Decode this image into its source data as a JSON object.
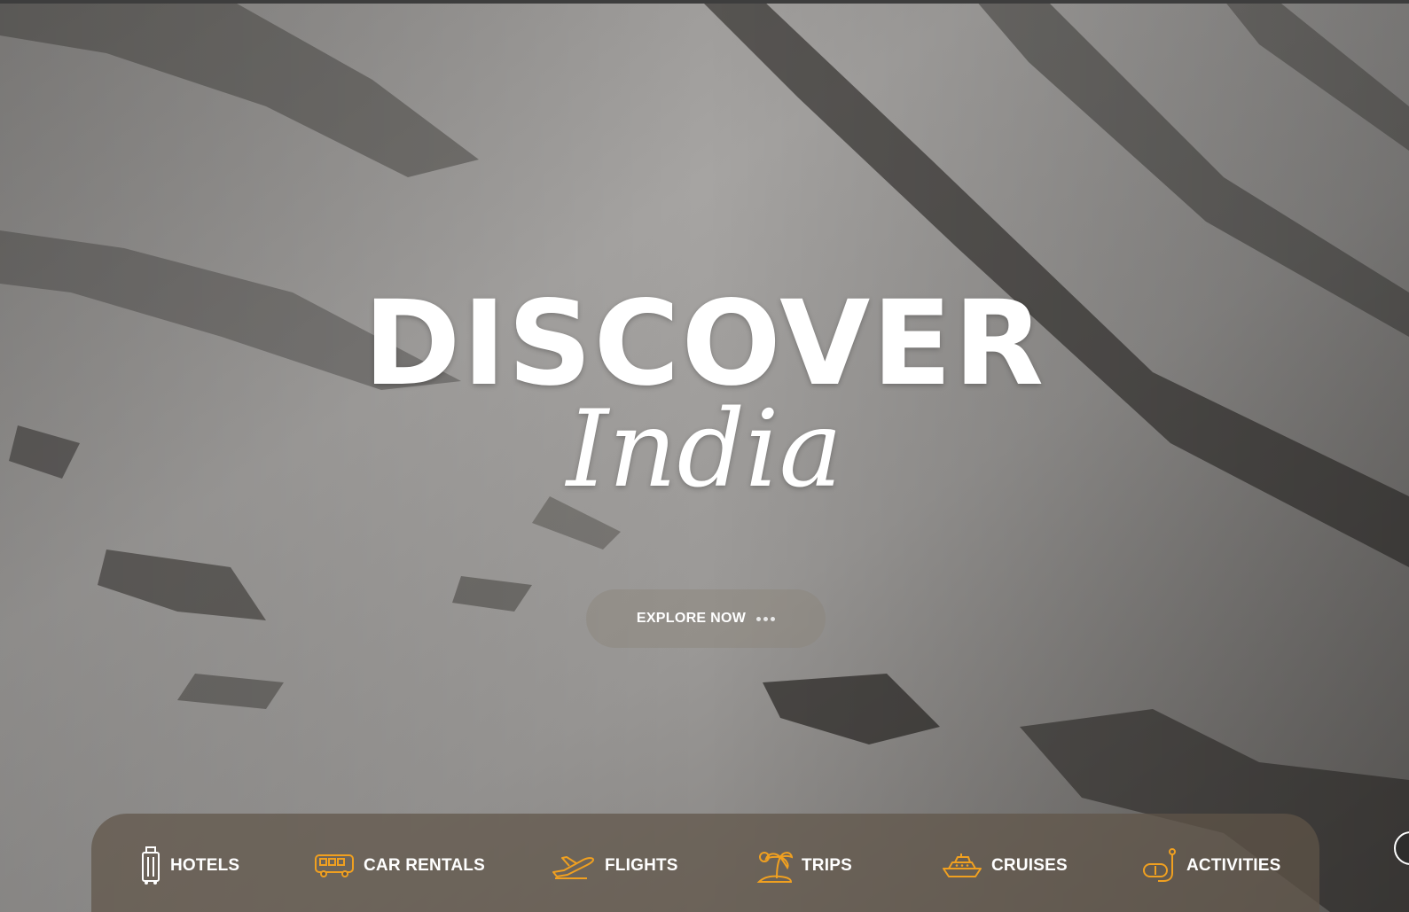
{
  "hero": {
    "headline": "DISCOVER",
    "subheadline": "India",
    "cta_label": "EXPLORE NOW"
  },
  "categories": [
    {
      "label": "HOTELS",
      "icon": "luggage-icon"
    },
    {
      "label": "CAR RENTALS",
      "icon": "bus-icon"
    },
    {
      "label": "FLIGHTS",
      "icon": "airplane-icon"
    },
    {
      "label": "TRIPS",
      "icon": "palm-island-icon"
    },
    {
      "label": "CRUISES",
      "icon": "ship-icon"
    },
    {
      "label": "ACTIVITIES",
      "icon": "snorkel-icon"
    }
  ],
  "colors": {
    "accent": "#f0a020",
    "text": "#ffffff",
    "bar": "#5f5448"
  }
}
